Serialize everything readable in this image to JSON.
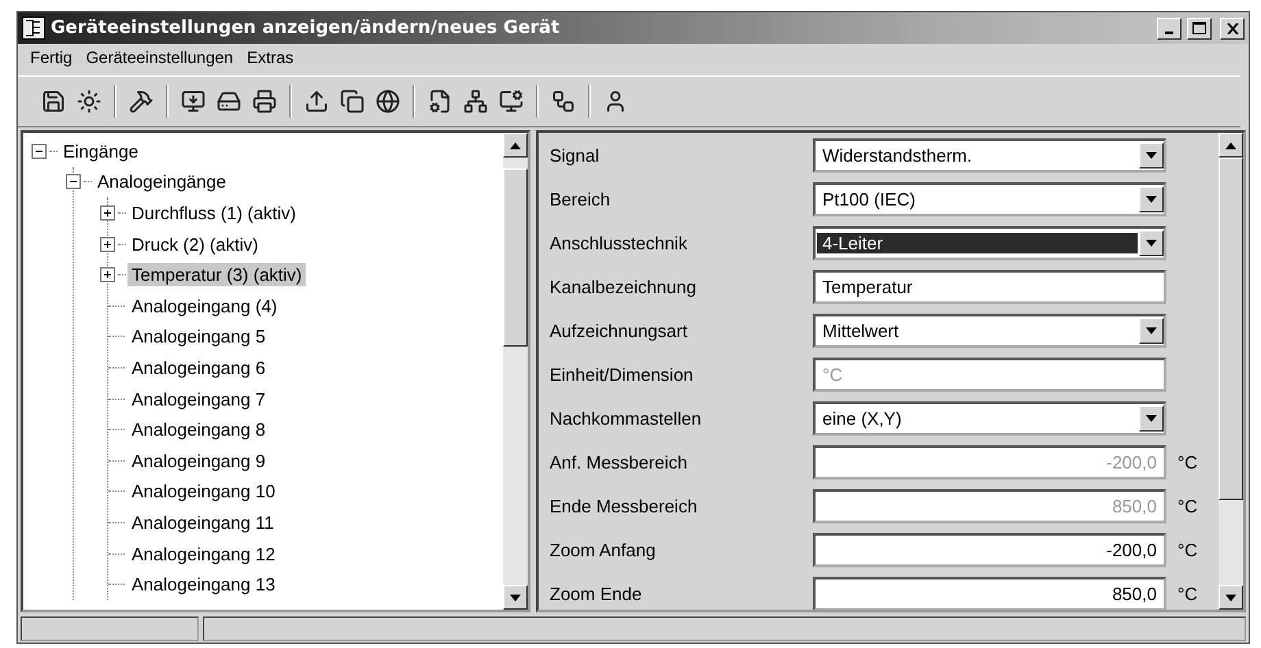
{
  "window": {
    "title": "Geräteeinstellungen anzeigen/ändern/neues Gerät"
  },
  "menu": [
    "Fertig",
    "Geräteeinstellungen",
    "Extras"
  ],
  "tree": [
    {
      "label": "Eingänge",
      "kind": "expanded",
      "selected": false,
      "children": [
        {
          "label": "Analogeingänge",
          "kind": "expanded",
          "selected": false,
          "children": [
            {
              "label": "Durchfluss (1) (aktiv)",
              "kind": "collapsed",
              "selected": false
            },
            {
              "label": "Druck (2) (aktiv)",
              "kind": "collapsed",
              "selected": false
            },
            {
              "label": "Temperatur (3) (aktiv)",
              "kind": "collapsed",
              "selected": true
            },
            {
              "label": "Analogeingang (4)",
              "kind": "leaf",
              "selected": false
            },
            {
              "label": "Analogeingang 5",
              "kind": "leaf",
              "selected": false
            },
            {
              "label": "Analogeingang 6",
              "kind": "leaf",
              "selected": false
            },
            {
              "label": "Analogeingang 7",
              "kind": "leaf",
              "selected": false
            },
            {
              "label": "Analogeingang 8",
              "kind": "leaf",
              "selected": false
            },
            {
              "label": "Analogeingang 9",
              "kind": "leaf",
              "selected": false
            },
            {
              "label": "Analogeingang 10",
              "kind": "leaf",
              "selected": false
            },
            {
              "label": "Analogeingang 11",
              "kind": "leaf",
              "selected": false
            },
            {
              "label": "Analogeingang 12",
              "kind": "leaf",
              "selected": false
            },
            {
              "label": "Analogeingang 13",
              "kind": "leaf",
              "selected": false
            }
          ]
        }
      ]
    }
  ],
  "fields": [
    {
      "label": "Signal",
      "kind": "dropdown",
      "value": "Widerstandstherm.",
      "disabled": false,
      "selected": false
    },
    {
      "label": "Bereich",
      "kind": "dropdown",
      "value": "Pt100 (IEC)",
      "disabled": false,
      "selected": false
    },
    {
      "label": "Anschlusstechnik",
      "kind": "dropdown",
      "value": "4-Leiter",
      "disabled": false,
      "selected": true
    },
    {
      "label": "Kanalbezeichnung",
      "kind": "text",
      "value": "Temperatur",
      "disabled": false,
      "selected": false
    },
    {
      "label": "Aufzeichnungsart",
      "kind": "dropdown",
      "value": "Mittelwert",
      "disabled": false,
      "selected": false
    },
    {
      "label": "Einheit/Dimension",
      "kind": "text",
      "value": "°C",
      "disabled": true,
      "selected": false
    },
    {
      "label": "Nachkommastellen",
      "kind": "dropdown",
      "value": "eine (X,Y)",
      "disabled": false,
      "selected": false
    },
    {
      "label": "Anf. Messbereich",
      "kind": "number",
      "value": "-200,0",
      "disabled": true,
      "selected": false,
      "unit": "°C"
    },
    {
      "label": "Ende Messbereich",
      "kind": "number",
      "value": "850,0",
      "disabled": true,
      "selected": false,
      "unit": "°C"
    },
    {
      "label": "Zoom Anfang",
      "kind": "number",
      "value": "-200,0",
      "disabled": false,
      "selected": false,
      "unit": "°C"
    },
    {
      "label": "Zoom Ende",
      "kind": "number",
      "value": "850,0",
      "disabled": false,
      "selected": false,
      "unit": "°C"
    }
  ]
}
